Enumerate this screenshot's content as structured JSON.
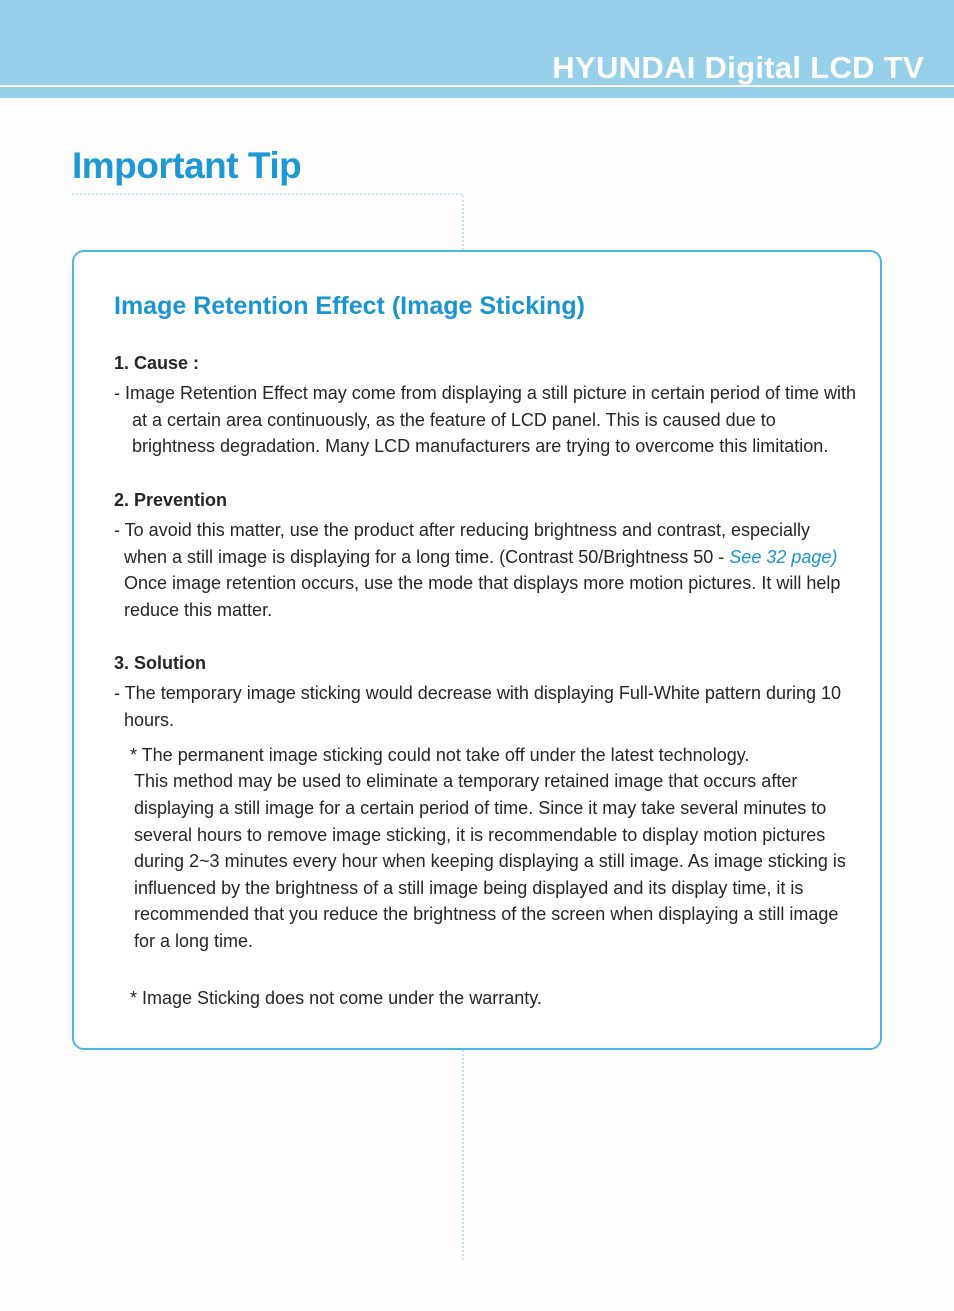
{
  "header": {
    "brand": "HYUNDAI Digital LCD TV"
  },
  "page_title": "Important Tip",
  "box": {
    "heading": "Image Retention Effect (Image Sticking)",
    "sections": {
      "cause": {
        "title": "1. Cause :",
        "body": "-  Image Retention Effect may come from displaying a still picture in certain period of time with at a certain area continuously, as the feature of LCD panel. This is caused due to brightness degradation. Many LCD manufacturers are trying to overcome this limitation."
      },
      "prevention": {
        "title": "2. Prevention",
        "body_pre": "- To avoid this matter, use the product after reducing brightness and contrast, especially when a still image is displaying for a long time. (Contrast 50/Brightness 50 - ",
        "link": "See 32 page)",
        "body_post": " Once image retention occurs, use the mode that displays more motion pictures. It will help reduce this matter."
      },
      "solution": {
        "title": "3. Solution",
        "line1": "- The temporary image sticking would decrease with displaying Full-White pattern during 10 hours.",
        "note1": "* The permanent image sticking could not take off under the latest technology.",
        "detail": "This method may be used to eliminate a temporary retained image that occurs after displaying a still image for a certain period of time. Since it may take several minutes to several hours to remove image sticking, it is recommendable to display motion pictures during 2~3 minutes every hour when keeping displaying a still image. As image sticking is influenced by the brightness of a still image being displayed and its display time, it is recommended that you reduce the brightness of the screen when displaying a still image for a long time.",
        "note2": "* Image Sticking does not come under the warranty."
      }
    }
  }
}
